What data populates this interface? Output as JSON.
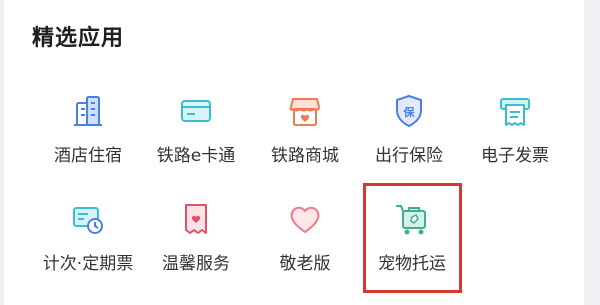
{
  "section": {
    "title": "精选应用"
  },
  "apps": [
    {
      "label": "酒店住宿",
      "icon": "hotel-building-icon"
    },
    {
      "label": "铁路e卡通",
      "icon": "railway-card-icon"
    },
    {
      "label": "铁路商城",
      "icon": "mall-shop-icon"
    },
    {
      "label": "出行保险",
      "icon": "insurance-shield-icon"
    },
    {
      "label": "电子发票",
      "icon": "invoice-printer-icon"
    },
    {
      "label": "计次·定期票",
      "icon": "periodic-ticket-icon"
    },
    {
      "label": "温馨服务",
      "icon": "warm-service-icon"
    },
    {
      "label": "敬老版",
      "icon": "heart-icon"
    },
    {
      "label": "宠物托运",
      "icon": "pet-transport-icon"
    }
  ],
  "highlight": {
    "target": "宠物托运",
    "color": "#d9382e"
  },
  "colors": {
    "blue": "#4a7fe8",
    "cyan": "#3bbdd0",
    "orange": "#f07a55",
    "pink": "#e8506a",
    "green": "#3fae8c"
  }
}
